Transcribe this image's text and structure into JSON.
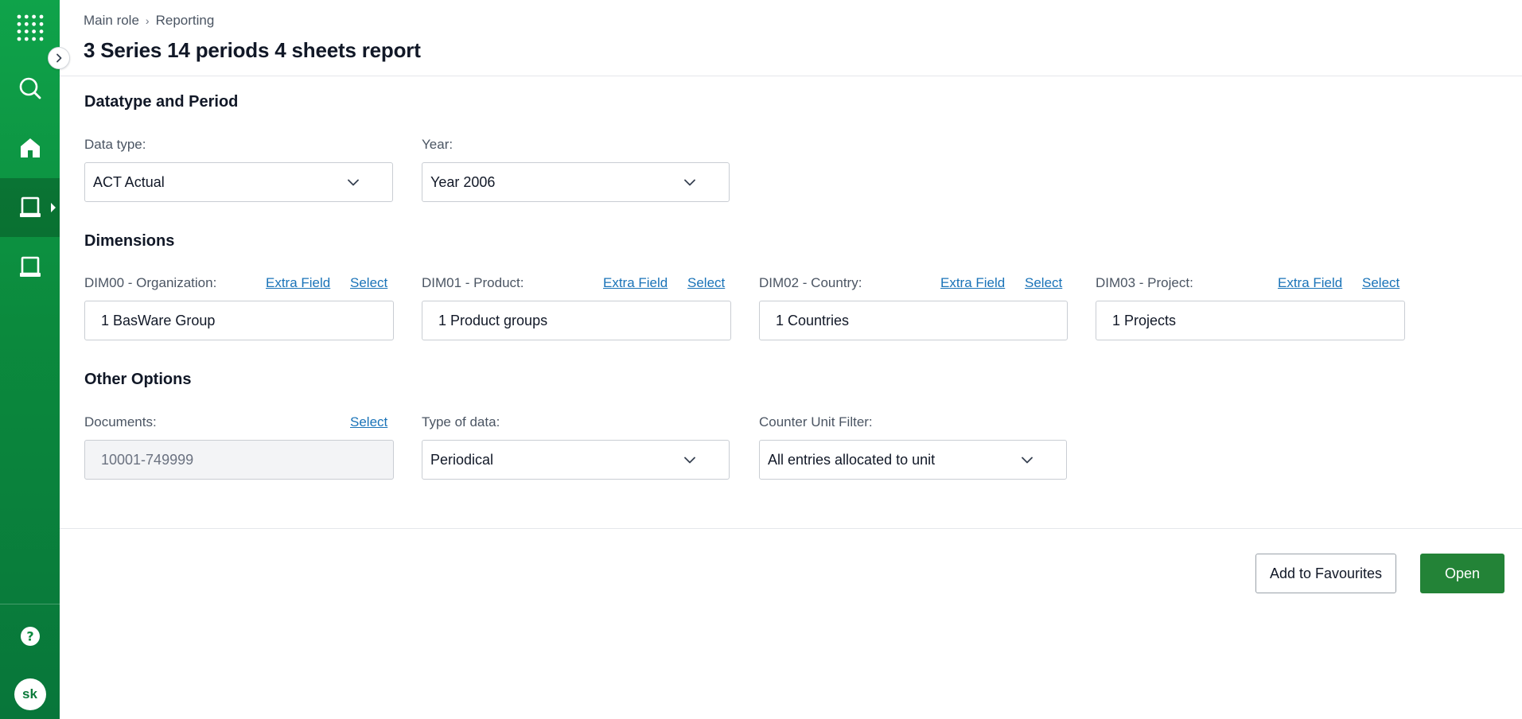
{
  "sidebar": {
    "icons": [
      "grid-menu-icon",
      "search-icon",
      "home-icon",
      "reporting-icon",
      "reports-icon",
      "help-icon"
    ],
    "avatar_initials": "sk",
    "colors": {
      "top": "#0fa34a",
      "bottom": "#08763a"
    }
  },
  "breadcrumb": {
    "root": "Main role",
    "separator": "›",
    "current": "Reporting"
  },
  "page": {
    "title": "3 Series 14 periods 4 sheets report"
  },
  "datatype_period": {
    "section_title": "Datatype and Period",
    "data_type": {
      "label": "Data type:",
      "value": "ACT Actual"
    },
    "year": {
      "label": "Year:",
      "value": "Year 2006"
    }
  },
  "dimensions": {
    "section_title": "Dimensions",
    "items": [
      {
        "label": "DIM00 - Organization:",
        "extra_field": "Extra Field",
        "select": "Select",
        "value": "1 BasWare Group"
      },
      {
        "label": "DIM01 - Product:",
        "extra_field": "Extra Field",
        "select": "Select",
        "value": "1 Product groups"
      },
      {
        "label": "DIM02 - Country:",
        "extra_field": "Extra Field",
        "select": "Select",
        "value": "1 Countries"
      },
      {
        "label": "DIM03 - Project:",
        "extra_field": "Extra Field",
        "select": "Select",
        "value": "1 Projects"
      }
    ]
  },
  "other_options": {
    "section_title": "Other Options",
    "documents": {
      "label": "Documents:",
      "select": "Select",
      "value": "10001-749999"
    },
    "type_of_data": {
      "label": "Type of data:",
      "value": "Periodical"
    },
    "counter_unit_filter": {
      "label": "Counter Unit Filter:",
      "value": "All entries allocated to unit"
    }
  },
  "actions": {
    "add_favourites": "Add to Favourites",
    "open": "Open",
    "primary_color": "#238337"
  }
}
